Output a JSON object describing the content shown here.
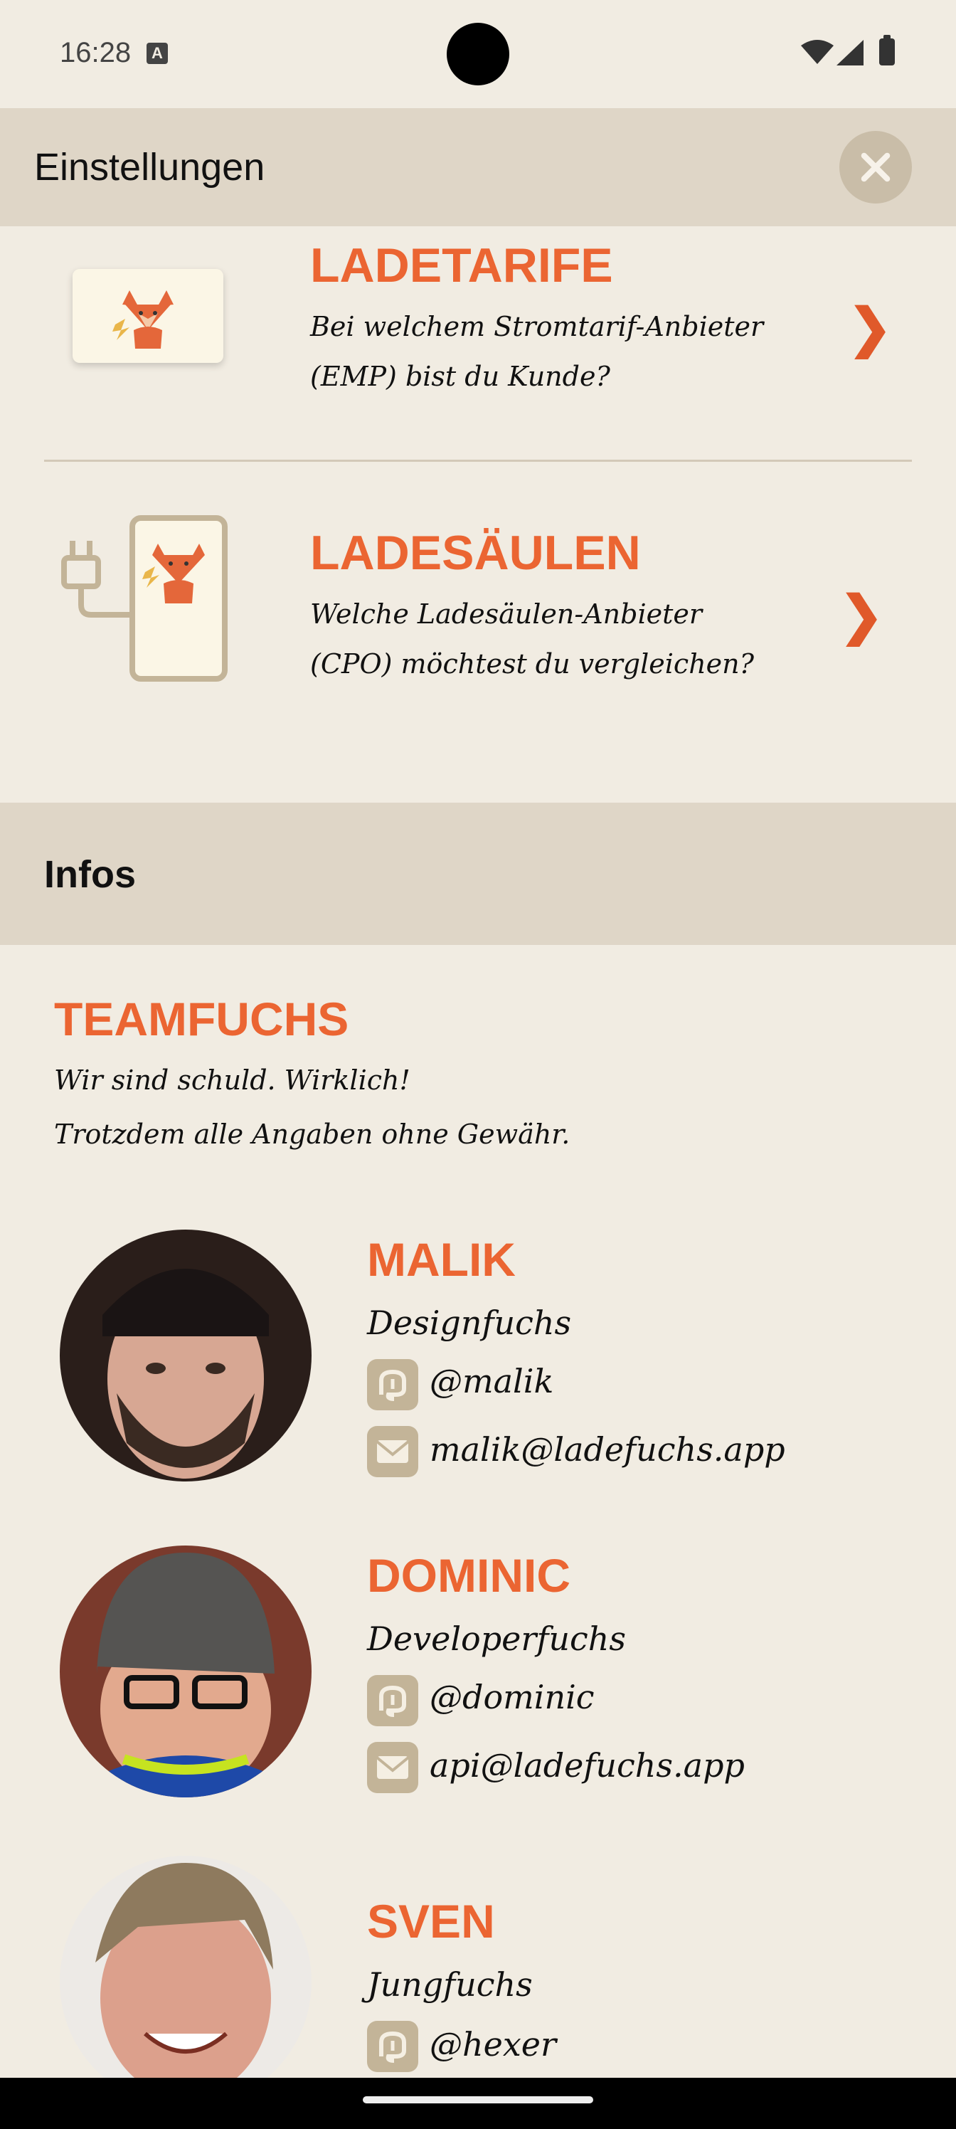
{
  "status_bar": {
    "time": "16:28",
    "notification_icon": "a-box-icon",
    "icons": [
      "wifi-icon",
      "signal-icon",
      "battery-icon"
    ]
  },
  "header": {
    "title": "Einstellungen",
    "close_icon": "close-icon"
  },
  "settings": [
    {
      "title": "LADETARIFE",
      "desc_line1": "Bei welchem Stromtarif-Anbieter",
      "desc_line2": "(EMP) bist du Kunde?",
      "chevron": "❯"
    },
    {
      "title": "LADESÄULEN",
      "desc_line1": "Welche Ladesäulen-Anbieter",
      "desc_line2": "(CPO) möchtest du vergleichen?",
      "chevron": "❯"
    }
  ],
  "infos": {
    "title": "Infos"
  },
  "team": {
    "title": "TEAMFUCHS",
    "line1": "Wir sind schuld. Wirklich!",
    "line2": "Trotzdem alle Angaben ohne Gewähr."
  },
  "people": [
    {
      "name": "MALIK",
      "role": "Designfuchs",
      "mastodon": "@malik",
      "email": "malik@ladefuchs.app"
    },
    {
      "name": "DOMINIC",
      "role": "Developerfuchs",
      "mastodon": "@dominic",
      "email": "api@ladefuchs.app"
    },
    {
      "name": "SVEN",
      "role": "Jungfuchs",
      "mastodon": "@hexer"
    }
  ],
  "colors": {
    "accent": "#EB6532",
    "background": "#F1ECE2",
    "header": "#DFD6C7",
    "icon_tile": "#C3B498"
  }
}
